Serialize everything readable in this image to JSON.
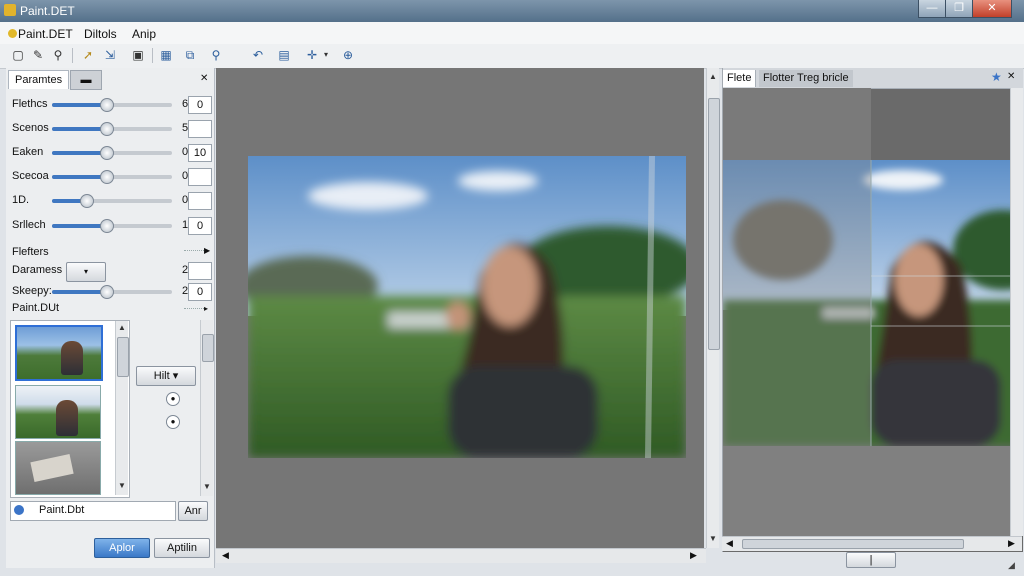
{
  "window": {
    "title": "Paint.DET",
    "controls": [
      "—",
      "❐",
      "✕"
    ]
  },
  "menu": {
    "items": [
      "Paint.DET",
      "Diltols",
      "Anip"
    ]
  },
  "toolbar": {
    "icons": [
      "new-icon",
      "brush-icon",
      "zoom-icon",
      "select-icon",
      "move-icon",
      "crop-icon",
      "grid-icon",
      "layers-icon",
      "search-icon",
      "undo-icon",
      "history-icon",
      "crosshair-icon",
      "dropdown-icon",
      "anchor-icon"
    ]
  },
  "left_panel": {
    "tabs": {
      "active": "Paramtes",
      "button": "▬",
      "close": "✕"
    },
    "params": [
      {
        "label": "Flethcs",
        "v1": "6",
        "v2": "0",
        "level": 0.45
      },
      {
        "label": "Scenos",
        "v1": "5",
        "v2": "",
        "level": 0.45
      },
      {
        "label": "Eaken",
        "v1": "0",
        "v2": "10",
        "level": 0.45
      },
      {
        "label": "Scecoa",
        "v1": "0",
        "v2": "",
        "level": 0.45
      },
      {
        "label": "1D.",
        "v1": "0",
        "v2": "",
        "level": 0.28
      },
      {
        "label": "Srllech",
        "v1": "1",
        "v2": "0",
        "level": 0.45
      }
    ],
    "filters_label": "Flefters",
    "daramess_label": "Daramess",
    "daramess_value": "2",
    "skeepy_label": "Skeepy:",
    "skeepy_v1": "2",
    "skeepy_v2": "0",
    "skeepy_level": 0.45,
    "paint_label": "Paint.DUt",
    "hilt_label": "Hilt",
    "bottom_field": "Paint.Dbt",
    "bottom_field_btn": "Anr",
    "apply_btn": "Aplor",
    "apply2_btn": "Aptilin"
  },
  "right_panel": {
    "tabs": [
      "Flete",
      "Flotter Treg bricle"
    ],
    "star": "★",
    "close": "✕"
  }
}
